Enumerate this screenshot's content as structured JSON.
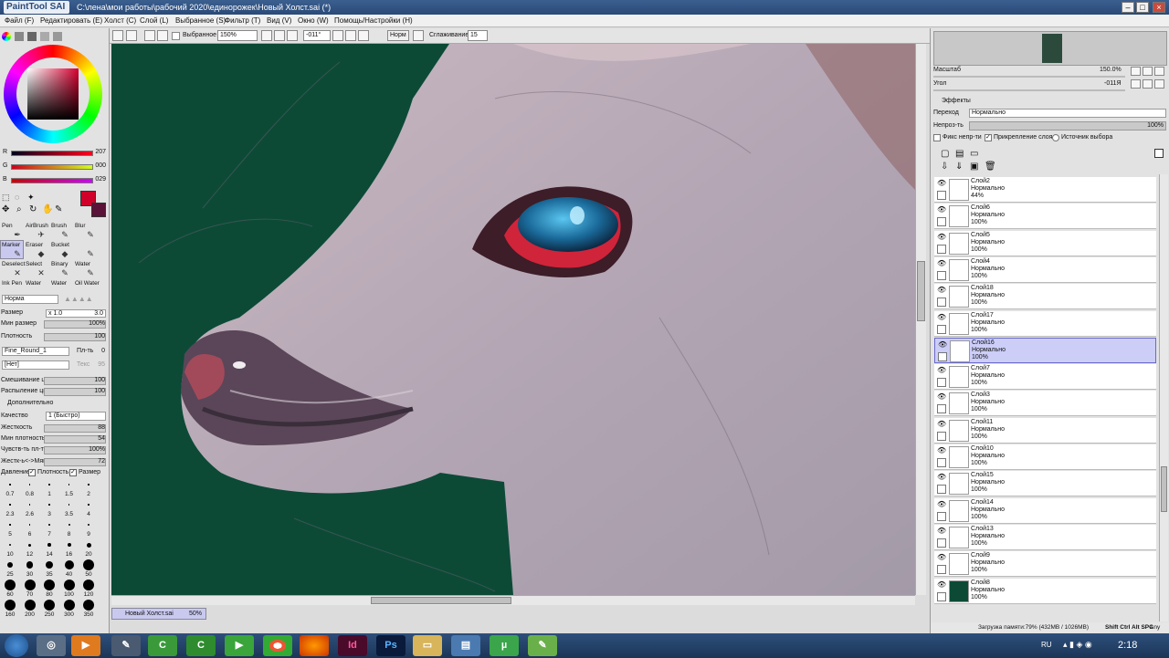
{
  "window": {
    "app_name": "PaintTool SAI",
    "title": "C:\\лена\\мои работы\\рабочий 2020\\единорожек\\Новый Холст.sai (*)"
  },
  "menu": [
    {
      "label": "Файл (F)"
    },
    {
      "label": "Редактировать (E)"
    },
    {
      "label": "Холст (C)"
    },
    {
      "label": "Слой (L)"
    },
    {
      "label": "Выбранное (S)"
    },
    {
      "label": "Фильтр (T)"
    },
    {
      "label": "Вид (V)"
    },
    {
      "label": "Окно (W)"
    },
    {
      "label": "Помощь/Настройки (H)"
    }
  ],
  "toolbar": {
    "selected_label": "Выбранное",
    "zoom": "150%",
    "angle": "-011°",
    "blend": "Норм",
    "stabilizer_label": "Сглаживание",
    "stabilizer": "15"
  },
  "color": {
    "current": "#cf0029",
    "secondary": "#5a1238",
    "r": {
      "label": "R",
      "value": "207"
    },
    "g": {
      "label": "G",
      "value": "000"
    },
    "b": {
      "label": "B",
      "value": "029"
    }
  },
  "tools": [
    {
      "label": "Pen"
    },
    {
      "label": "AirBrush"
    },
    {
      "label": "Brush"
    },
    {
      "label": "Blur"
    },
    {
      "label": "Marker"
    },
    {
      "label": "Eraser"
    },
    {
      "label": "Bucket"
    },
    {
      "label": ""
    },
    {
      "label": "Deselect"
    },
    {
      "label": "Select"
    },
    {
      "label": "Binary"
    },
    {
      "label": "Water"
    },
    {
      "label": "Ink Pen"
    },
    {
      "label": "Water"
    },
    {
      "label": "Water"
    },
    {
      "label": "Oil Water"
    }
  ],
  "brush": {
    "blend": "Норма",
    "size_label": "Размер",
    "size_mult": "x 1.0",
    "size": "3.0",
    "min_size_label": "Мин размер",
    "min_size": "100%",
    "density_label": "Плотность",
    "density": "100",
    "shape": "Fine_Round_1",
    "shape_strength_label": "Пл-ть",
    "shape_strength": "0",
    "texture": "[Нет]",
    "texture_strength_label": "Текс",
    "texture_strength": "95",
    "blend_color_label": "Смешивание цве",
    "blend_color": "100",
    "dilution_label": "Распыление цвет",
    "dilution": "100",
    "advanced_label": "Дополнительно",
    "quality_label": "Качество",
    "quality": "1 (Быстро)",
    "hardness_label": "Жесткость",
    "hardness": "88",
    "min_density_label": "Мин плотность",
    "min_density": "54",
    "sens_label": "Чувств-ть пл-ти",
    "sens": "100%",
    "hs_label": "Жестк-ь<->Мягк",
    "hs": "72",
    "pressure_label": "Давление:",
    "press_density_label": "Плотность",
    "press_size_label": "Размер"
  },
  "brush_sizes": [
    "0.7",
    "0.8",
    "1",
    "1.5",
    "2",
    "2.3",
    "2.6",
    "3",
    "3.5",
    "4",
    "5",
    "6",
    "7",
    "8",
    "9",
    "10",
    "12",
    "14",
    "16",
    "20",
    "25",
    "30",
    "35",
    "40",
    "50",
    "60",
    "70",
    "80",
    "100",
    "120",
    "160",
    "200",
    "250",
    "300",
    "350"
  ],
  "document_tab": {
    "name": "Новый Холст.sai",
    "zoom": "50%"
  },
  "navigator": {
    "scale_label": "Масштаб",
    "scale": "150.0%",
    "angle_label": "Угол",
    "angle": "-011Я"
  },
  "layer_panel": {
    "effects_label": "Эффекты",
    "mode_label": "Переход",
    "mode": "Нормально",
    "opacity_label": "Непроз-ть",
    "opacity": "100%",
    "preserve_opacity": "Фикс непр-ти",
    "clipping": "Прикрепление слоя",
    "selection_source": "Источник выбора"
  },
  "layers": [
    {
      "name": "Слой2",
      "mode": "Нормально",
      "opacity": "44%"
    },
    {
      "name": "Слой6",
      "mode": "Нормально",
      "opacity": "100%"
    },
    {
      "name": "Слой5",
      "mode": "Нормально",
      "opacity": "100%"
    },
    {
      "name": "Слой4",
      "mode": "Нормально",
      "opacity": "100%"
    },
    {
      "name": "Слой18",
      "mode": "Нормально",
      "opacity": "100%"
    },
    {
      "name": "Слой17",
      "mode": "Нормально",
      "opacity": "100%"
    },
    {
      "name": "Слой16",
      "mode": "Нормально",
      "opacity": "100%",
      "selected": true
    },
    {
      "name": "Слой7",
      "mode": "Нормально",
      "opacity": "100%"
    },
    {
      "name": "Слой3",
      "mode": "Нормально",
      "opacity": "100%"
    },
    {
      "name": "Слой11",
      "mode": "Нормально",
      "opacity": "100%"
    },
    {
      "name": "Слой10",
      "mode": "Нормально",
      "opacity": "100%"
    },
    {
      "name": "Слой15",
      "mode": "Нормально",
      "opacity": "100%"
    },
    {
      "name": "Слой14",
      "mode": "Нормально",
      "opacity": "100%"
    },
    {
      "name": "Слой13",
      "mode": "Нормально",
      "opacity": "100%"
    },
    {
      "name": "Слой9",
      "mode": "Нормально",
      "opacity": "100%"
    },
    {
      "name": "Слой8",
      "mode": "Нормально",
      "opacity": "100%"
    }
  ],
  "status": {
    "memory": "Загрузка памяти:79% (432MB / 1026MB)",
    "keys": "Shift Ctrl Alt SPC",
    "any": "Any"
  },
  "taskbar": {
    "apps": [
      "AI",
      "Id",
      "Ps"
    ],
    "lang": "RU",
    "time": "2:18"
  }
}
